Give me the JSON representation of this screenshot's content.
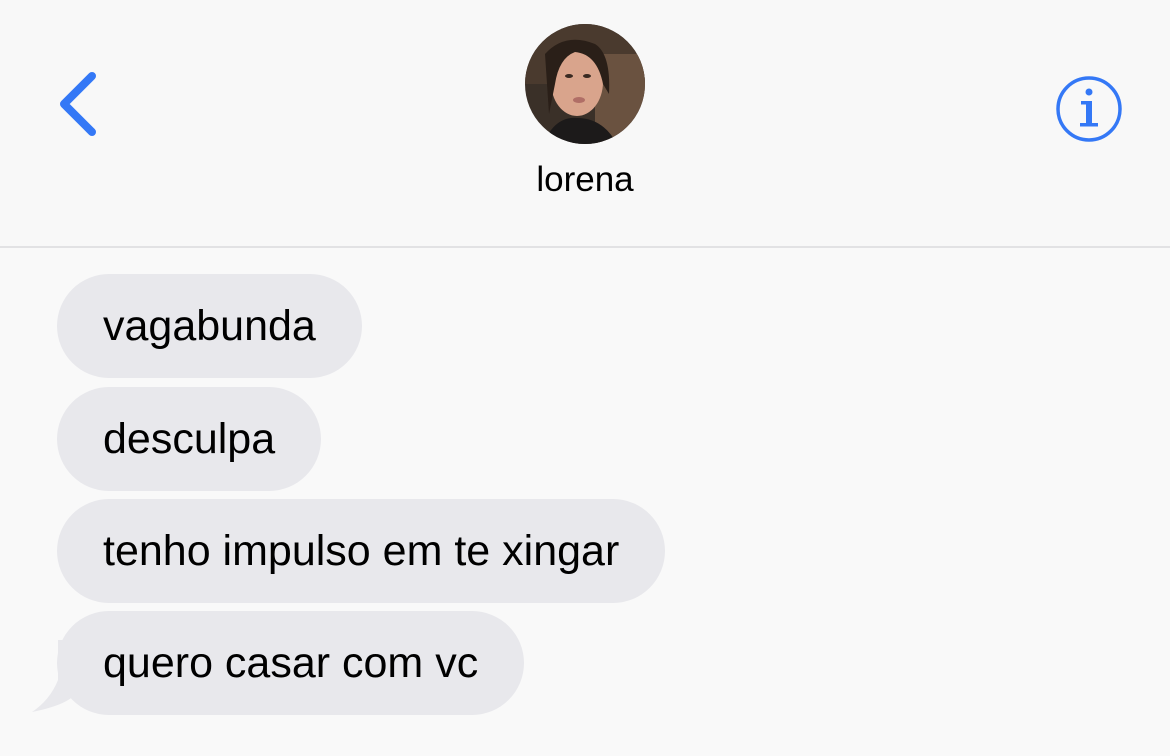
{
  "header": {
    "contact_name": "lorena",
    "back_icon": "chevron-left-icon",
    "info_icon": "info-circle-icon",
    "accent_color": "#3478f6"
  },
  "messages": [
    {
      "text": "vagabunda",
      "direction": "received"
    },
    {
      "text": "desculpa",
      "direction": "received"
    },
    {
      "text": "tenho impulso em te xingar",
      "direction": "received"
    },
    {
      "text": "quero casar com vc",
      "direction": "received"
    }
  ],
  "colors": {
    "background": "#f9f9f9",
    "received_bubble": "#e8e8ec",
    "separator": "#e2e2e4"
  }
}
